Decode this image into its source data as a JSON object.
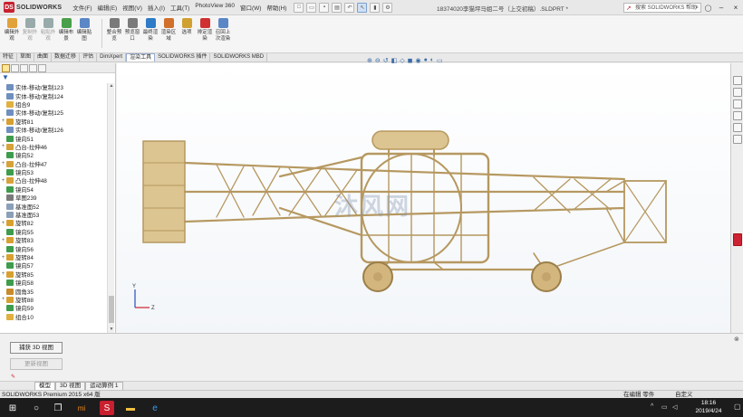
{
  "app": {
    "logo_text": "SOLIDWORKS",
    "document_title": "18374020李猫坪马姐二号（上交初稿）.SLDPRT *"
  },
  "menu": [
    "文件(F)",
    "编辑(E)",
    "视图(V)",
    "插入(I)",
    "工具(T)",
    "PhotoView 360",
    "窗口(W)",
    "帮助(H)"
  ],
  "search": {
    "placeholder": "搜索 SOLIDWORKS 帮助"
  },
  "commands": [
    {
      "label": "编辑外\n观",
      "enabled": true
    },
    {
      "label": "复制外\n观",
      "enabled": false
    },
    {
      "label": "粘贴外\n观",
      "enabled": false
    },
    {
      "label": "编辑布\n景",
      "enabled": true
    },
    {
      "label": "编辑贴\n图",
      "enabled": true
    },
    {
      "label": "整合预\n览",
      "enabled": true
    },
    {
      "label": "预览窗\n口",
      "enabled": true
    },
    {
      "label": "最终渲\n染",
      "enabled": true
    },
    {
      "label": "渲染区\n域",
      "enabled": true
    },
    {
      "label": "选项",
      "enabled": true
    },
    {
      "label": "排定渲\n染",
      "enabled": true
    },
    {
      "label": "召回上\n次渲染",
      "enabled": true
    }
  ],
  "tabs": [
    "特征",
    "草图",
    "曲面",
    "数据迁移",
    "评估",
    "DimXpert",
    "渲染工具",
    "SOLIDWORKS 插件",
    "SOLIDWORKS MBD"
  ],
  "active_tab": "渲染工具",
  "tree": [
    {
      "label": "实体-移动/复制123",
      "icon": "solid-move",
      "expand": ""
    },
    {
      "label": "实体-移动/复制124",
      "icon": "solid-move",
      "expand": ""
    },
    {
      "label": "组合9",
      "icon": "combine",
      "expand": ""
    },
    {
      "label": "实体-移动/复制125",
      "icon": "solid-move",
      "expand": ""
    },
    {
      "label": "旋转81",
      "icon": "revolve",
      "expand": "+"
    },
    {
      "label": "实体-移动/复制126",
      "icon": "solid-move",
      "expand": ""
    },
    {
      "label": "镜向51",
      "icon": "mirror",
      "expand": ""
    },
    {
      "label": "凸台-拉伸46",
      "icon": "extrude",
      "expand": "+"
    },
    {
      "label": "镜向52",
      "icon": "mirror",
      "expand": ""
    },
    {
      "label": "凸台-拉伸47",
      "icon": "extrude",
      "expand": "+"
    },
    {
      "label": "镜向53",
      "icon": "mirror",
      "expand": ""
    },
    {
      "label": "凸台-拉伸48",
      "icon": "extrude",
      "expand": "+"
    },
    {
      "label": "镜向54",
      "icon": "mirror",
      "expand": ""
    },
    {
      "label": "草图239",
      "icon": "sketch",
      "expand": ""
    },
    {
      "label": "基准面52",
      "icon": "plane",
      "expand": ""
    },
    {
      "label": "基准面53",
      "icon": "plane",
      "expand": ""
    },
    {
      "label": "旋转82",
      "icon": "revolve",
      "expand": "+"
    },
    {
      "label": "镜向55",
      "icon": "mirror",
      "expand": ""
    },
    {
      "label": "旋转83",
      "icon": "revolve",
      "expand": "+"
    },
    {
      "label": "镜向56",
      "icon": "mirror",
      "expand": ""
    },
    {
      "label": "旋转84",
      "icon": "revolve",
      "expand": "+"
    },
    {
      "label": "镜向57",
      "icon": "mirror",
      "expand": ""
    },
    {
      "label": "旋转85",
      "icon": "revolve",
      "expand": "+"
    },
    {
      "label": "镜向58",
      "icon": "mirror",
      "expand": ""
    },
    {
      "label": "圆角35",
      "icon": "fillet",
      "expand": ""
    },
    {
      "label": "旋转88",
      "icon": "revolve",
      "expand": "+"
    },
    {
      "label": "镜向59",
      "icon": "mirror",
      "expand": ""
    },
    {
      "label": "组合10",
      "icon": "combine",
      "expand": ""
    }
  ],
  "bottom": {
    "capture_label": "捕获 3D 视图",
    "update_label": "更新视图"
  },
  "bottom_tabs": [
    "模型",
    "3D 视图",
    "运动算例 1"
  ],
  "status": {
    "left": "SOLIDWORKS Premium 2015 x64 版",
    "editing": "在编辑 零件",
    "units": "自定义"
  },
  "watermark": "沐风网",
  "clock": {
    "time": "18:16",
    "date": "2019/4/24"
  },
  "colors": {
    "model": "#d8bf8a",
    "model_dark": "#b69860",
    "accent": "#c8202f"
  }
}
